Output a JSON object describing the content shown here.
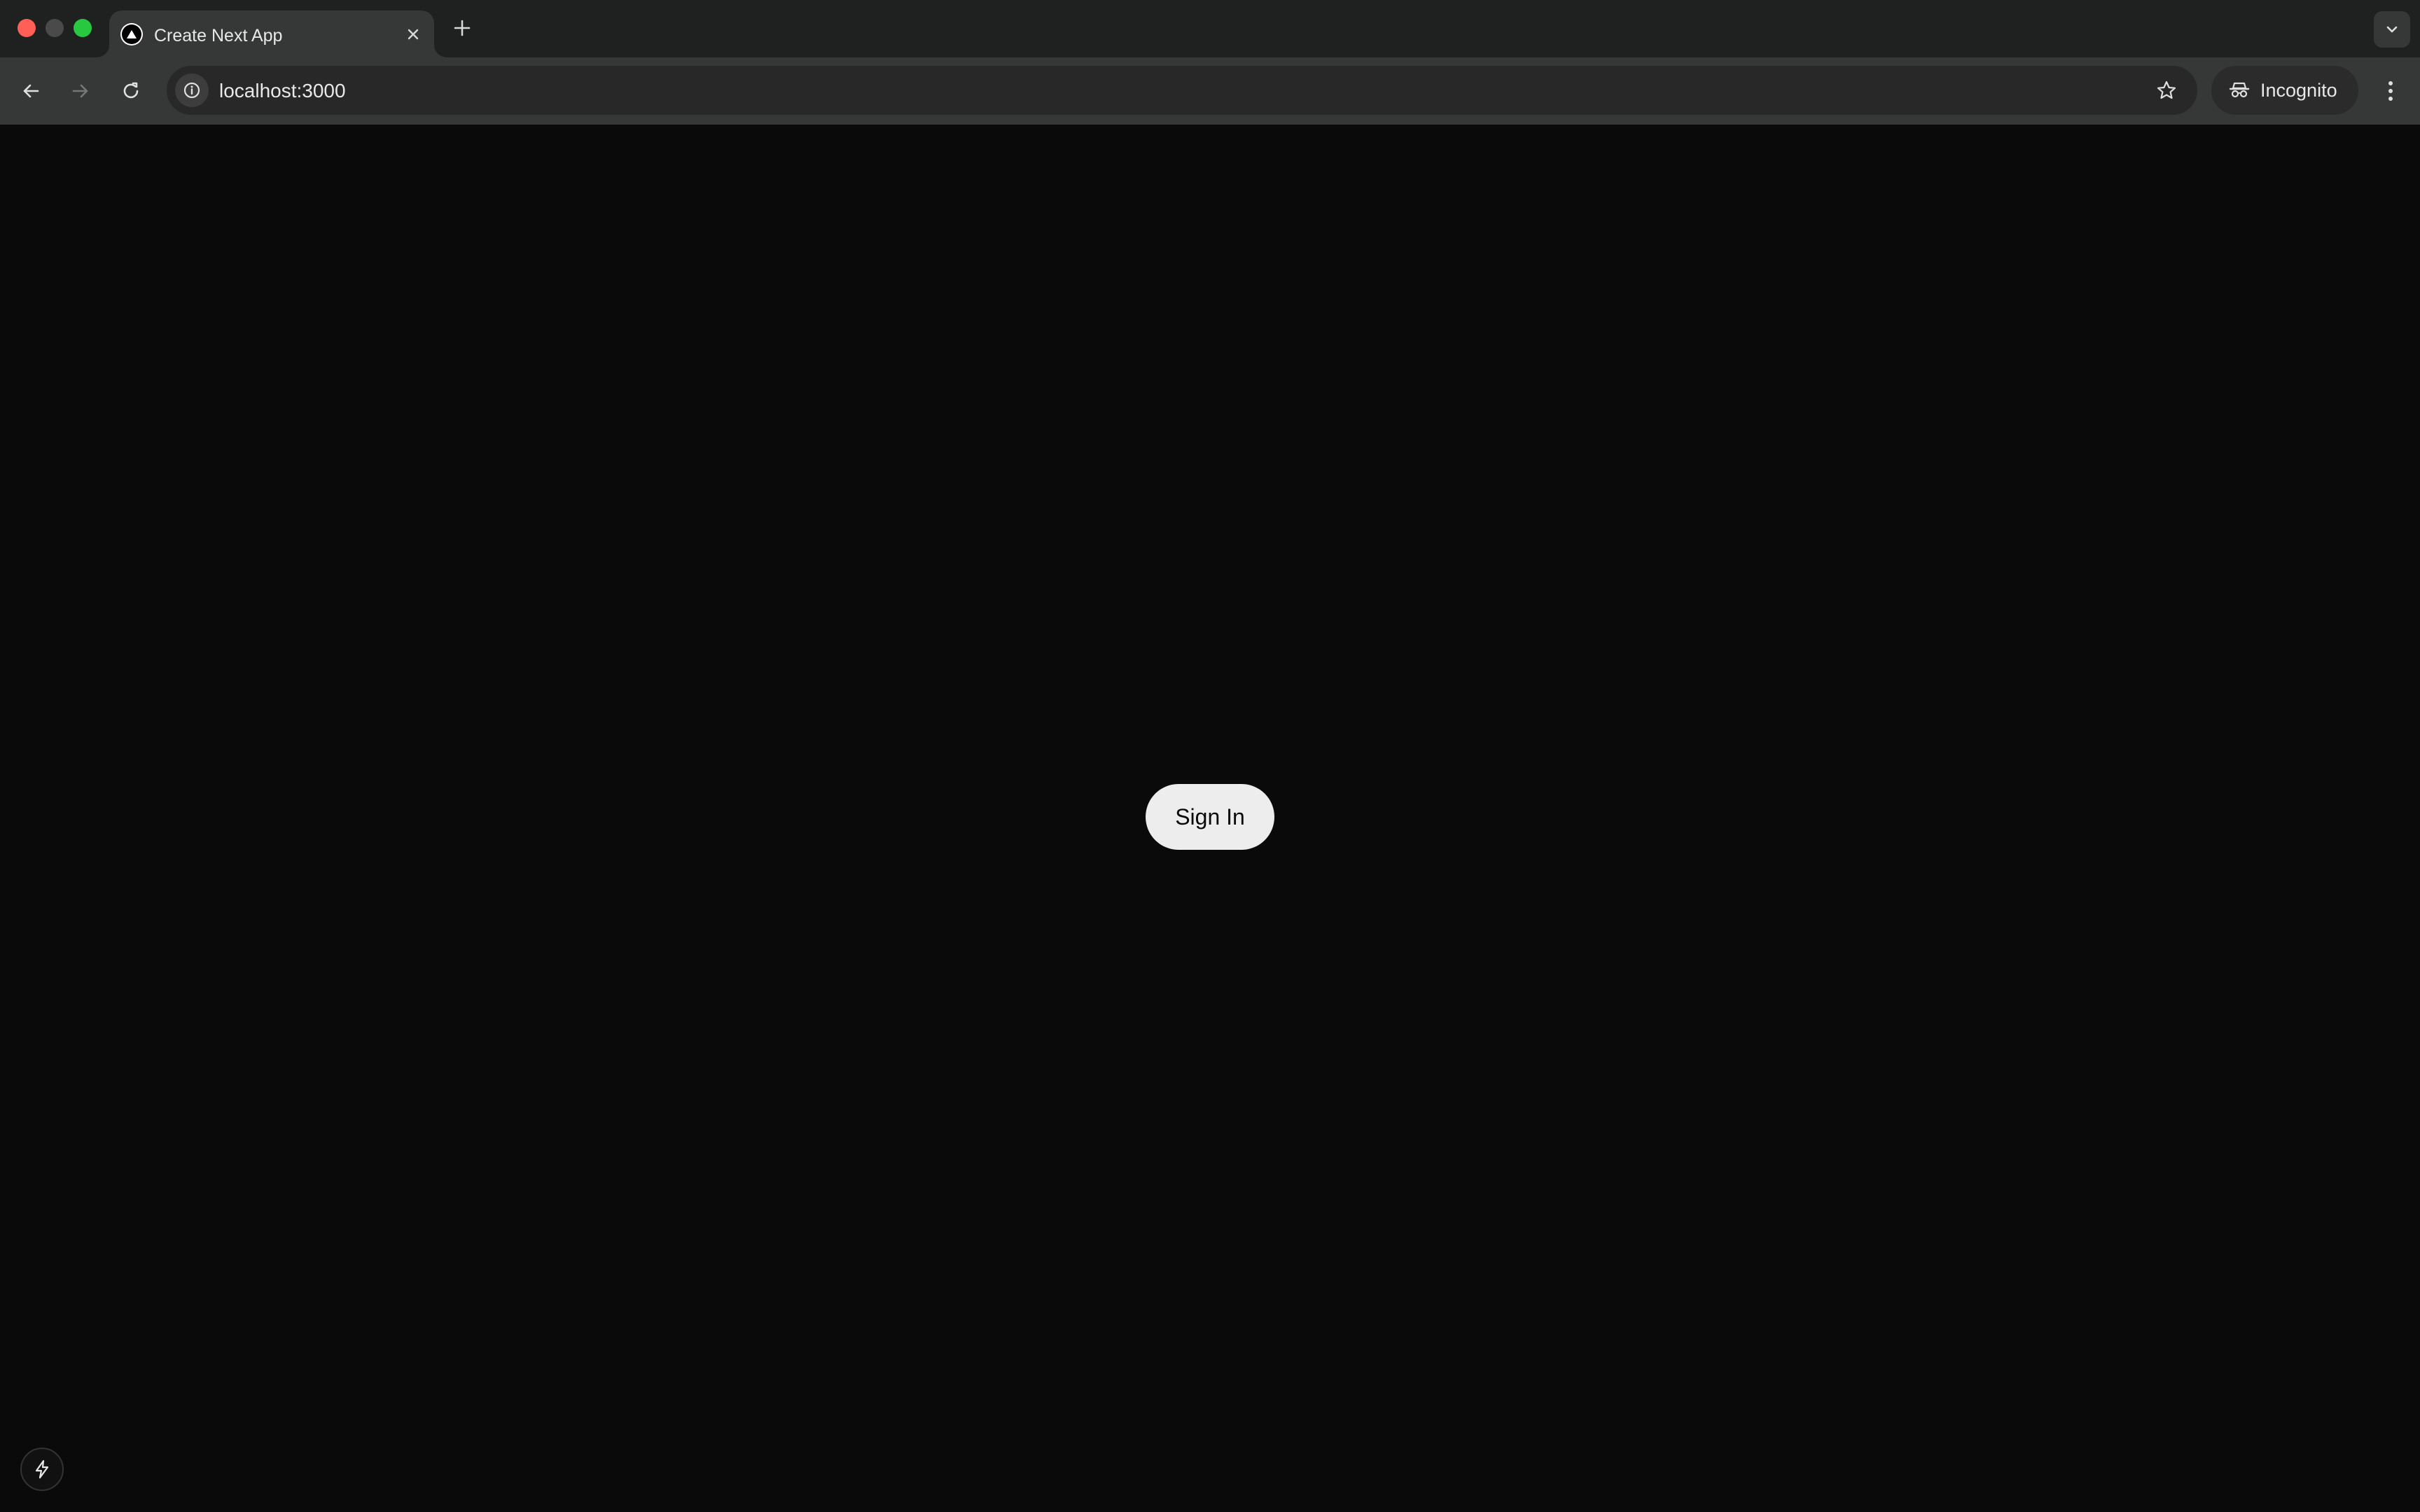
{
  "browser": {
    "tab": {
      "title": "Create Next App"
    },
    "toolbar": {
      "url": "localhost:3000",
      "profile_label": "Incognito"
    }
  },
  "page": {
    "signin_label": "Sign In"
  },
  "icons": {
    "tab_favicon": "nextjs-triangle-icon",
    "tab_close": "close-icon",
    "new_tab": "plus-icon",
    "tab_search": "chevron-down-icon",
    "back": "arrow-left-icon",
    "forward": "arrow-right-icon",
    "reload": "reload-icon",
    "site_info": "info-icon",
    "bookmark": "star-icon",
    "incognito": "incognito-icon",
    "menu": "kebab-menu-icon",
    "devtools": "lightning-bolt-icon"
  },
  "colors": {
    "page_background": "#0a0a0a",
    "button_background": "#ededed",
    "button_text": "#0a0a0a",
    "traffic_close": "#ff5f57",
    "traffic_minimize": "#4a4a4a",
    "traffic_maximize": "#28c840"
  }
}
